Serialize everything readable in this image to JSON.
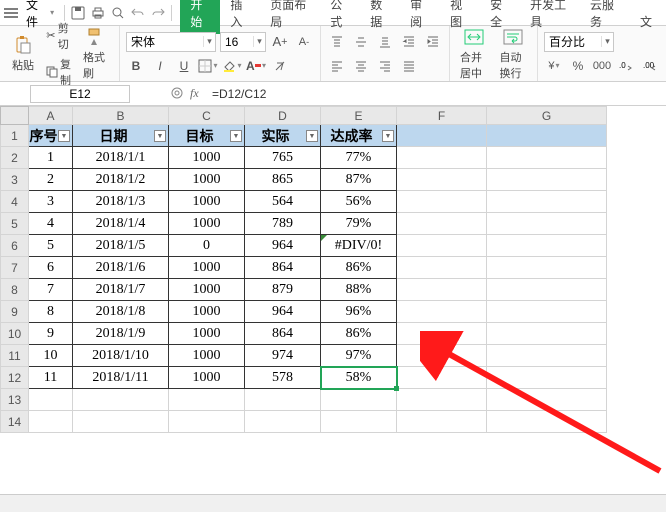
{
  "menu": {
    "file": "文件",
    "tabs": [
      "开始",
      "插入",
      "页面布局",
      "公式",
      "数据",
      "审阅",
      "视图",
      "安全",
      "开发工具",
      "云服务",
      "文"
    ],
    "activeIndex": 0
  },
  "ribbon": {
    "paste": "粘贴",
    "cut": "剪切",
    "copy": "复制",
    "formatPainter": "格式刷",
    "font": {
      "name": "宋体",
      "size": "16"
    },
    "mergeCenter": "合并居中",
    "wrap": "自动换行",
    "percentLabel": "百分比"
  },
  "formula": {
    "cellRef": "E12",
    "text": "=D12/C12"
  },
  "grid": {
    "cols": [
      "A",
      "B",
      "C",
      "D",
      "E",
      "F",
      "G"
    ],
    "headers": [
      "序号",
      "日期",
      "目标",
      "实际",
      "达成率"
    ],
    "rows": [
      {
        "n": "1",
        "date": "2018/1/1",
        "target": "1000",
        "actual": "765",
        "rate": "77%"
      },
      {
        "n": "2",
        "date": "2018/1/2",
        "target": "1000",
        "actual": "865",
        "rate": "87%"
      },
      {
        "n": "3",
        "date": "2018/1/3",
        "target": "1000",
        "actual": "564",
        "rate": "56%"
      },
      {
        "n": "4",
        "date": "2018/1/4",
        "target": "1000",
        "actual": "789",
        "rate": "79%"
      },
      {
        "n": "5",
        "date": "2018/1/5",
        "target": "0",
        "actual": "964",
        "rate": "#DIV/0!"
      },
      {
        "n": "6",
        "date": "2018/1/6",
        "target": "1000",
        "actual": "864",
        "rate": "86%"
      },
      {
        "n": "7",
        "date": "2018/1/7",
        "target": "1000",
        "actual": "879",
        "rate": "88%"
      },
      {
        "n": "8",
        "date": "2018/1/8",
        "target": "1000",
        "actual": "964",
        "rate": "96%"
      },
      {
        "n": "9",
        "date": "2018/1/9",
        "target": "1000",
        "actual": "864",
        "rate": "86%"
      },
      {
        "n": "10",
        "date": "2018/1/10",
        "target": "1000",
        "actual": "974",
        "rate": "97%"
      },
      {
        "n": "11",
        "date": "2018/1/11",
        "target": "1000",
        "actual": "578",
        "rate": "58%"
      }
    ],
    "blankRows": [
      13,
      14
    ]
  },
  "chart_data": {
    "type": "table",
    "title": "",
    "columns": [
      "序号",
      "日期",
      "目标",
      "实际",
      "达成率"
    ],
    "rows": [
      [
        1,
        "2018/1/1",
        1000,
        765,
        0.77
      ],
      [
        2,
        "2018/1/2",
        1000,
        865,
        0.87
      ],
      [
        3,
        "2018/1/3",
        1000,
        564,
        0.56
      ],
      [
        4,
        "2018/1/4",
        1000,
        789,
        0.79
      ],
      [
        5,
        "2018/1/5",
        0,
        964,
        null
      ],
      [
        6,
        "2018/1/6",
        1000,
        864,
        0.86
      ],
      [
        7,
        "2018/1/7",
        1000,
        879,
        0.88
      ],
      [
        8,
        "2018/1/8",
        1000,
        964,
        0.96
      ],
      [
        9,
        "2018/1/9",
        1000,
        864,
        0.86
      ],
      [
        10,
        "2018/1/10",
        1000,
        974,
        0.97
      ],
      [
        11,
        "2018/1/11",
        1000,
        578,
        0.58
      ]
    ]
  }
}
